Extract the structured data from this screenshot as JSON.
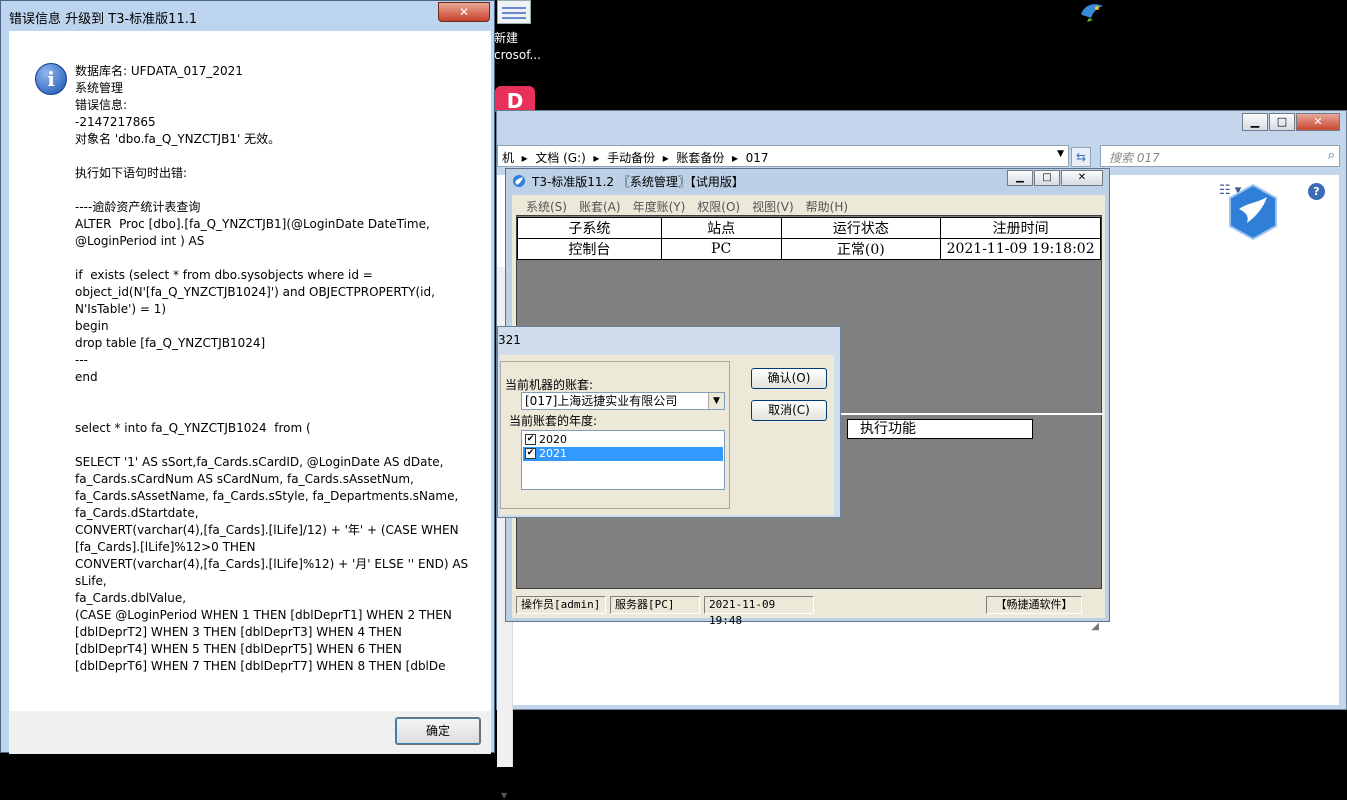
{
  "desktop": {
    "shortcut_label_line1": "新建",
    "shortcut_label_line2": "crosof...",
    "red_app_letter": "D"
  },
  "explorer": {
    "caption_min": "▁",
    "caption_max": "□",
    "caption_close": "✕",
    "address_text": "机  ▸  文档 (G:)  ▸  手动备份  ▸  账套备份  ▸  017",
    "search_placeholder": "搜索 017",
    "help_label": "?"
  },
  "t3": {
    "title": "T3-标准版11.2 〖系统管理〗【试用版】",
    "menu": [
      "系统(S)",
      "账套(A)",
      "年度账(Y)",
      "权限(O)",
      "视图(V)",
      "帮助(H)"
    ],
    "table_headers": [
      "子系统",
      "站点",
      "运行状态",
      "注册时间"
    ],
    "table_rows": [
      [
        "控制台",
        "PC",
        "正常(0)",
        "2021-11-09 19:18:02"
      ]
    ],
    "exec_label": "执行功能",
    "status": {
      "operator": "操作员[admin]",
      "server": "服务器[PC]",
      "time": "2021-11-09 19:48",
      "company": "【畅捷通软件】"
    }
  },
  "login": {
    "title_fragment": "321",
    "account_label": "当前机器的账套:",
    "account_value": "[017]上海远捷实业有限公司",
    "year_label": "当前账套的年度:",
    "years": [
      {
        "label": "2020",
        "checked": true,
        "selected": false
      },
      {
        "label": "2021",
        "checked": true,
        "selected": true
      }
    ],
    "confirm_button": "确认(O)",
    "cancel_button": "取消(C)"
  },
  "error_dialog": {
    "title": "错误信息  升级到 T3-标准版11.1",
    "close_label": "✕",
    "message": "数据库名: UFDATA_017_2021\n系统管理\n错误信息:\n-2147217865\n对象名 'dbo.fa_Q_YNZCTJB1' 无效。\n\n执行如下语句时出错:\n\n----逾龄资产统计表查询\nALTER  Proc [dbo].[fa_Q_YNZCTJB1](@LoginDate DateTime,\n@LoginPeriod int ) AS\n\nif  exists (select * from dbo.sysobjects where id =\nobject_id(N'[fa_Q_YNZCTJB1024]') and OBJECTPROPERTY(id,\nN'IsTable') = 1)\nbegin\ndrop table [fa_Q_YNZCTJB1024]\n---\nend\n\n\nselect * into fa_Q_YNZCTJB1024  from (\n\nSELECT '1' AS sSort,fa_Cards.sCardID, @LoginDate AS dDate,\nfa_Cards.sCardNum AS sCardNum, fa_Cards.sAssetNum,\nfa_Cards.sAssetName, fa_Cards.sStyle, fa_Departments.sName,\nfa_Cards.dStartdate,\nCONVERT(varchar(4),[fa_Cards].[lLife]/12) + '年' + (CASE WHEN\n[fa_Cards].[lLife]%12>0 THEN\nCONVERT(varchar(4),[fa_Cards].[lLife]%12) + '月' ELSE '' END) AS\nsLife,\nfa_Cards.dblValue,\n(CASE @LoginPeriod WHEN 1 THEN [dblDeprT1] WHEN 2 THEN\n[dblDeprT2] WHEN 3 THEN [dblDeprT3] WHEN 4 THEN\n[dblDeprT4] WHEN 5 THEN [dblDeprT5] WHEN 6 THEN\n[dblDeprT6] WHEN 7 THEN [dblDeprT7] WHEN 8 THEN [dblDe",
    "ok_button": "确定"
  }
}
